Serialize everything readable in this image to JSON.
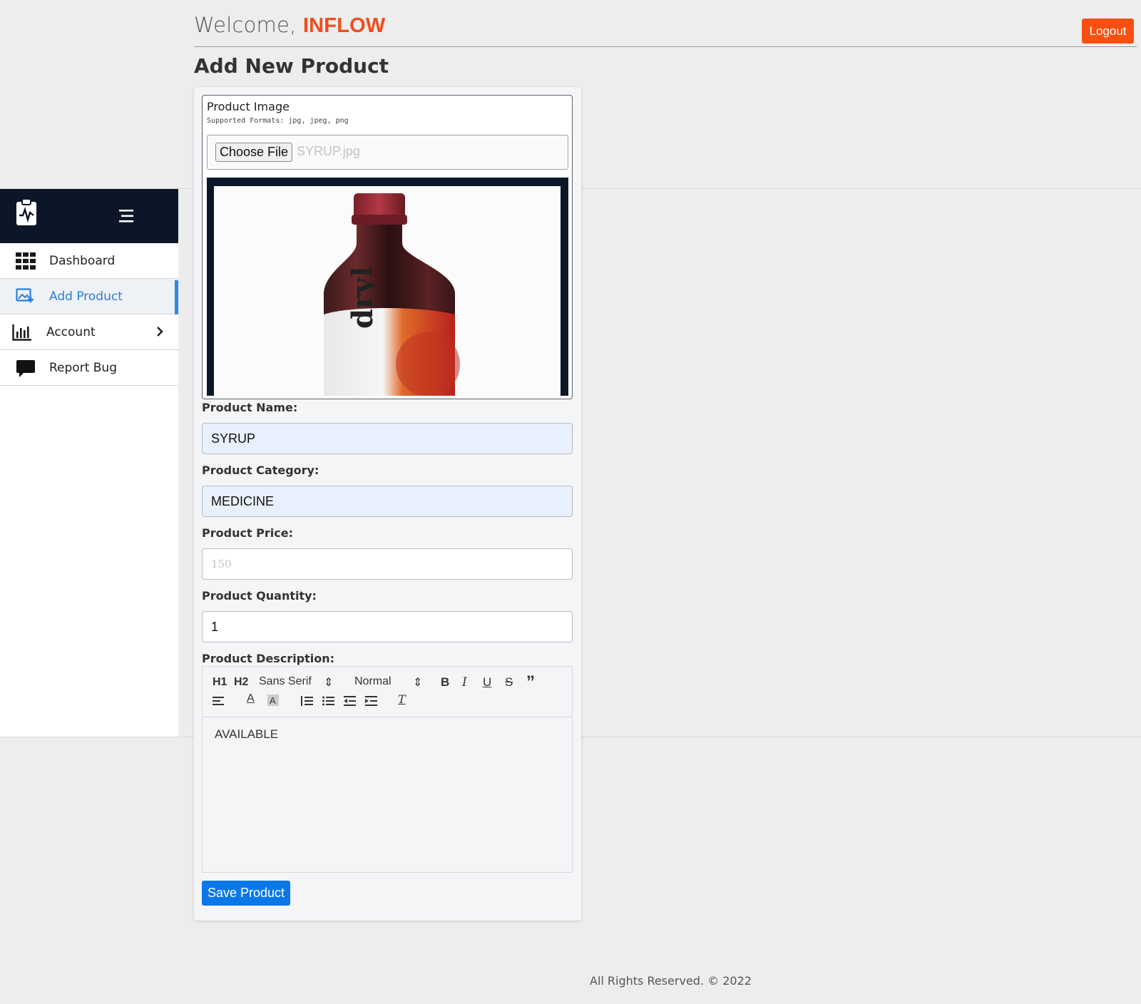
{
  "header": {
    "welcome_prefix": "Welcome,",
    "username": "INFLOW",
    "logout_label": "Logout",
    "page_title": "Add New Product"
  },
  "sidebar": {
    "items": [
      {
        "label": "Dashboard",
        "icon": "grid-icon"
      },
      {
        "label": "Add Product",
        "icon": "add-image-icon",
        "active": true
      },
      {
        "label": "Account",
        "icon": "bar-chart-icon"
      },
      {
        "label": "Report Bug",
        "icon": "chat-bubble-icon"
      }
    ]
  },
  "form": {
    "image_label": "Product Image",
    "image_hint": "Supported Formats: jpg, jpeg, png",
    "choose_file_label": "Choose File",
    "file_name": "SYRUP.jpg",
    "name_label": "Product Name:",
    "name_value": "SYRUP",
    "category_label": "Product Category:",
    "category_value": "MEDICINE",
    "price_label": "Product Price:",
    "price_placeholder": "150",
    "quantity_label": "Product Quantity:",
    "quantity_value": "1",
    "description_label": "Product Description:",
    "description_value": "AVAILABLE",
    "save_label": "Save Product"
  },
  "editor_toolbar": {
    "h1": "H1",
    "h2": "H2",
    "font": "Sans Serif",
    "size": "Normal"
  },
  "preview_label_text": "dryl",
  "footer": {
    "text": "All Rights Reserved. © 2022"
  },
  "colors": {
    "accent_orange": "#fa4f10",
    "sidebar_dark": "#0b1729",
    "active_blue": "#2f86e8",
    "save_blue": "#0b78e8"
  }
}
